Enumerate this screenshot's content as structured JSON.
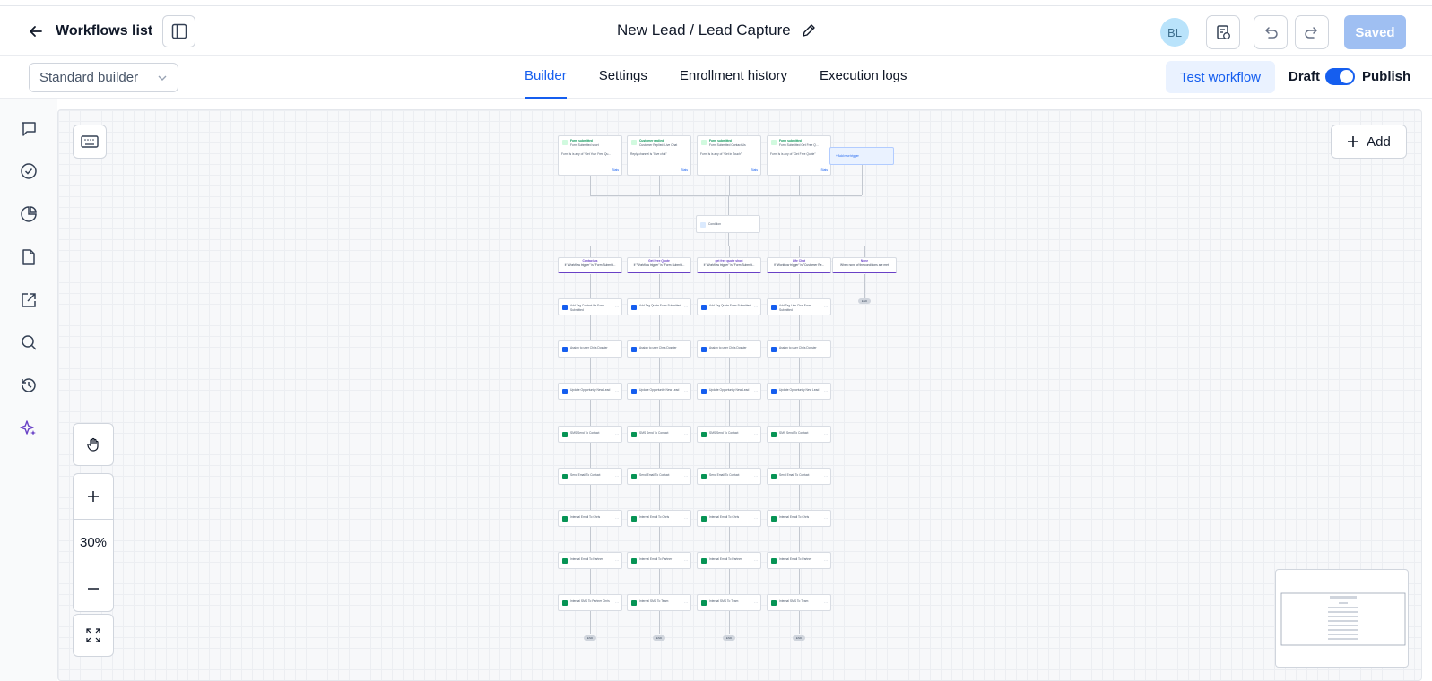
{
  "header": {
    "back_label": "Workflows list",
    "title": "New Lead / Lead Capture",
    "avatar_initials": "BL",
    "saved_label": "Saved"
  },
  "subbar": {
    "builder_select": "Standard builder",
    "tabs": [
      {
        "label": "Builder",
        "active": true
      },
      {
        "label": "Settings",
        "active": false
      },
      {
        "label": "Enrollment history",
        "active": false
      },
      {
        "label": "Execution logs",
        "active": false
      }
    ],
    "test_label": "Test workflow",
    "draft_label": "Draft",
    "publish_label": "Publish",
    "publish_on": true
  },
  "leftnav": {
    "icons": [
      "chat-icon",
      "check-circle-icon",
      "pie-chart-icon",
      "document-icon",
      "external-link-icon",
      "search-icon",
      "history-icon",
      "sparkle-icon"
    ]
  },
  "canvas": {
    "add_label": "Add",
    "zoom": "30%",
    "triggers": [
      {
        "title": "Form submitted",
        "sub": "Form Submitted short",
        "filter": "Form Is is any of \"Get Your Free Qu...",
        "stats": "Stats"
      },
      {
        "title": "Customer replied",
        "sub": "Customer Replied: Live Chat",
        "filter": "Reply channel is \"Live chat\"",
        "stats": "Stats"
      },
      {
        "title": "Form submitted",
        "sub": "Form Submitted Contact Us",
        "filter": "Form Is is any of \"Get in Touch\"",
        "stats": "Stats"
      },
      {
        "title": "Form submitted",
        "sub": "Form Submitted Get Free Q...",
        "filter": "Form Is is any of \"Get Free Quote\"",
        "stats": "Stats"
      }
    ],
    "add_trigger": "Add new trigger",
    "condition": "Condition",
    "branches": [
      {
        "name": "Contact us",
        "desc": "If \"Workflow trigger\" is \"Form Submitt..."
      },
      {
        "name": "Get Free Quote",
        "desc": "If \"Workflow trigger\" is \"Form Submitt..."
      },
      {
        "name": "get free quote short",
        "desc": "If \"Workflow trigger\" is \"Form Submitt..."
      },
      {
        "name": "Life Chat",
        "desc": "If \"Workflow trigger\" is \"Customer Re..."
      },
      {
        "name": "None",
        "desc": "When none of the conditions are met"
      }
    ],
    "columns": [
      [
        "Add Tag Contact Us Form Submitted",
        "Assign to user Chris Dossier",
        "Update Opportunity New Lead",
        "SMS Send To Contact",
        "Send Email To Contact",
        "Internal Email To Chris",
        "Internal Email To Partner",
        "Internal SMS To Partner Chris"
      ],
      [
        "Add Tag Quote Form Submitted",
        "Assign to user Chris Dossier",
        "Update Opportunity New Lead",
        "SMS Send To Contact",
        "Send Email To Contact",
        "Internal Email To Chris",
        "Internal Email To Partner",
        "Internal SMS To Team"
      ],
      [
        "Add Tag Quote Form Submitted",
        "Assign to user Chris Dossier",
        "Update Opportunity New Lead",
        "SMS Send To Contact",
        "Send Email To Contact",
        "Internal Email To Chris",
        "Internal Email To Partner",
        "Internal SMS To Team"
      ],
      [
        "Add Tag Live Chat Form Submitted",
        "Assign to user Chris Dossier",
        "Update Opportunity New Lead",
        "SMS Send To Contact",
        "Send Email To Contact",
        "Internal Email To Chris",
        "Internal Email To Partner",
        "Internal SMS To Team"
      ]
    ],
    "step_colors": [
      "#155eef",
      "#155eef",
      "#155eef",
      "#079455",
      "#079455",
      "#079455",
      "#079455",
      "#079455"
    ],
    "end_label": "END"
  },
  "colors": {
    "accent": "#155eef",
    "saved_bg": "#9fbff2",
    "avatar_bg": "#b9e3fb",
    "branch_accent": "#6941c6"
  }
}
